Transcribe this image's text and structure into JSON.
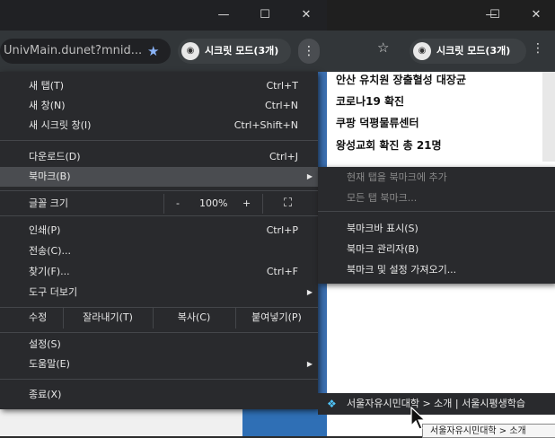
{
  "front_window": {
    "url_text": "UnivMain.dunet?mnid...",
    "incognito_label": "시크릿 모드(3개)",
    "controls": {
      "minimize": "—",
      "maximize": "☐",
      "close": "✕"
    }
  },
  "back_window": {
    "incognito_label": "시크릿 모드(3개)",
    "news": [
      "안산 유치원 장출혈성 대장균",
      "코로나19 확진",
      "쿠팡 덕평물류센터",
      "왕성교회 확진 총 21명"
    ]
  },
  "menu": {
    "items": [
      {
        "label": "새 탭(T)",
        "shortcut": "Ctrl+T"
      },
      {
        "label": "새 창(N)",
        "shortcut": "Ctrl+N"
      },
      {
        "label": "새 시크릿 창(I)",
        "shortcut": "Ctrl+Shift+N"
      },
      {
        "label": "다운로드(D)",
        "shortcut": "Ctrl+J"
      },
      {
        "label": "북마크(B)",
        "shortcut": ""
      },
      {
        "label": "인쇄(P)",
        "shortcut": "Ctrl+P"
      },
      {
        "label": "전송(C)...",
        "shortcut": ""
      },
      {
        "label": "찾기(F)...",
        "shortcut": "Ctrl+F"
      },
      {
        "label": "도구 더보기",
        "shortcut": ""
      },
      {
        "label": "설정(S)",
        "shortcut": ""
      },
      {
        "label": "도움말(E)",
        "shortcut": ""
      },
      {
        "label": "종료(X)",
        "shortcut": ""
      }
    ],
    "zoom": {
      "label": "글꼴 크기",
      "minus": "-",
      "value": "100%",
      "plus": "+"
    },
    "edit": {
      "label": "수정",
      "cut": "잘라내기(T)",
      "copy": "복사(C)",
      "paste": "붙여넣기(P)"
    }
  },
  "bookmark_submenu": {
    "items": [
      {
        "label": "현재 탭을 북마크에 추가",
        "disabled": true
      },
      {
        "label": "모든 탭 북마크...",
        "disabled": true
      },
      {
        "label": "북마크바 표시(S)",
        "disabled": false
      },
      {
        "label": "북마크 관리자(B)",
        "disabled": false
      },
      {
        "label": "북마크 및 설정 가져오기...",
        "disabled": false
      }
    ]
  },
  "bookmark_bar_item": "서울자유시민대학 > 소개 | 서울시평생학습",
  "tooltip": "서울자유시민대학 > 소개"
}
